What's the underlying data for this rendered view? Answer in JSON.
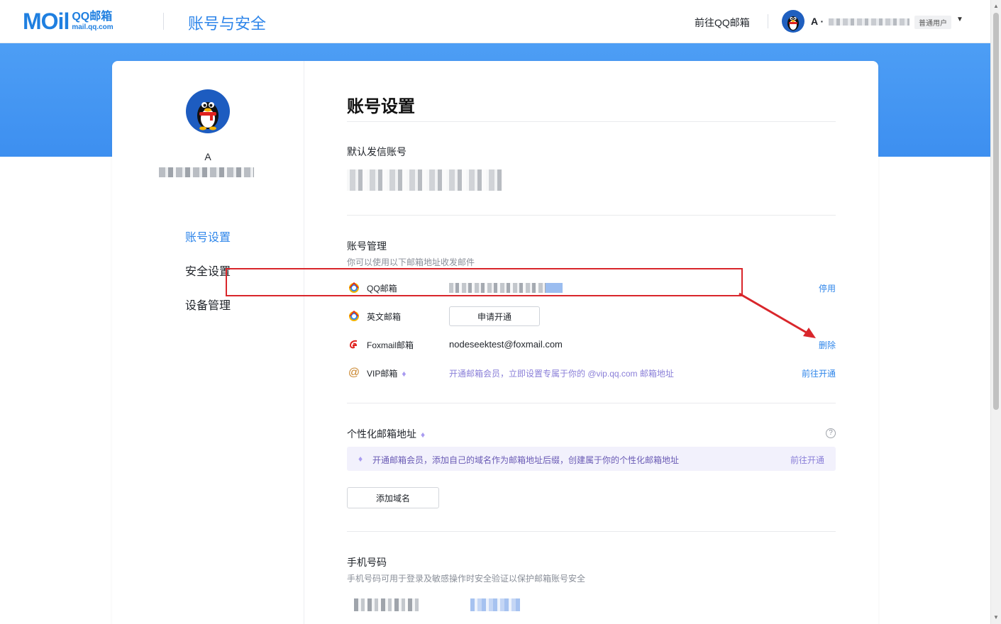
{
  "brand": {
    "logo_word": "MOil",
    "logo_cn": "QQ邮箱",
    "logo_domain": "mail.qq.com"
  },
  "header": {
    "page_title": "账号与安全",
    "goto_qq_mail": "前往QQ邮箱",
    "user_initial": "A ·",
    "user_badge": "普通用户",
    "dropdown_icon": "▼"
  },
  "sidebar": {
    "profile_initial": "A",
    "items": [
      {
        "label": "账号设置",
        "active": true
      },
      {
        "label": "安全设置",
        "active": false
      },
      {
        "label": "设备管理",
        "active": false
      }
    ]
  },
  "main": {
    "title": "账号设置",
    "default_sender": {
      "label": "默认发信账号"
    },
    "account_management": {
      "label": "账号管理",
      "desc": "你可以使用以下邮箱地址收发邮件",
      "rows": [
        {
          "icon": "qq-mail-icon",
          "name": "QQ邮箱",
          "value": "",
          "action": "停用"
        },
        {
          "icon": "english-mail-icon",
          "name": "英文邮箱",
          "button": "申请开通",
          "action": ""
        },
        {
          "icon": "foxmail-icon",
          "name": "Foxmail邮箱",
          "value": "nodeseektest@foxmail.com",
          "action": "删除"
        },
        {
          "icon": "vip-at-icon",
          "name": "VIP邮箱",
          "value": "开通邮箱会员，立即设置专属于你的 @vip.qq.com 邮箱地址",
          "action": "前往开通"
        }
      ]
    },
    "custom_domain": {
      "label": "个性化邮箱地址",
      "help": "?",
      "promo_text": "开通邮箱会员，添加自己的域名作为邮箱地址后缀，创建属于你的个性化邮箱地址",
      "promo_link": "前往开通",
      "add_button": "添加域名"
    },
    "phone": {
      "label": "手机号码",
      "desc": "手机号码可用于登录及敏感操作时安全验证以保护邮箱账号安全"
    }
  },
  "colors": {
    "accent": "#2f86ea",
    "band": "#3d8ff0",
    "highlight": "#d9262b",
    "vip": "#8a7fd8"
  }
}
